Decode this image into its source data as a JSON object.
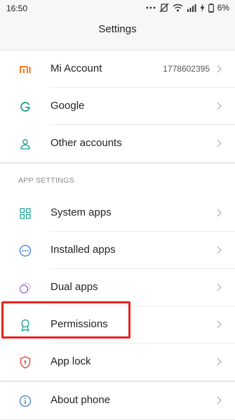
{
  "status": {
    "time": "16:50",
    "battery": "6%"
  },
  "header": {
    "title": "Settings"
  },
  "accounts": [
    {
      "name": "mi-account",
      "label": "Mi Account",
      "value": "1778602395",
      "icon": "mi-logo-icon"
    },
    {
      "name": "google",
      "label": "Google",
      "value": "",
      "icon": "google-icon"
    },
    {
      "name": "other-accounts",
      "label": "Other accounts",
      "value": "",
      "icon": "person-icon"
    }
  ],
  "app_settings": {
    "header": "APP SETTINGS",
    "items": [
      {
        "name": "system-apps",
        "label": "System apps",
        "icon": "grid-icon"
      },
      {
        "name": "installed-apps",
        "label": "Installed apps",
        "icon": "dots-circle-icon"
      },
      {
        "name": "dual-apps",
        "label": "Dual apps",
        "icon": "dual-circles-icon"
      },
      {
        "name": "permissions",
        "label": "Permissions",
        "icon": "badge-icon"
      },
      {
        "name": "app-lock",
        "label": "App lock",
        "icon": "shield-icon"
      }
    ]
  },
  "about": {
    "label": "About phone",
    "icon": "info-icon"
  },
  "colors": {
    "highlight": "#e8231f",
    "mi_orange": "#ff6700",
    "teal": "#1a9e8f"
  }
}
